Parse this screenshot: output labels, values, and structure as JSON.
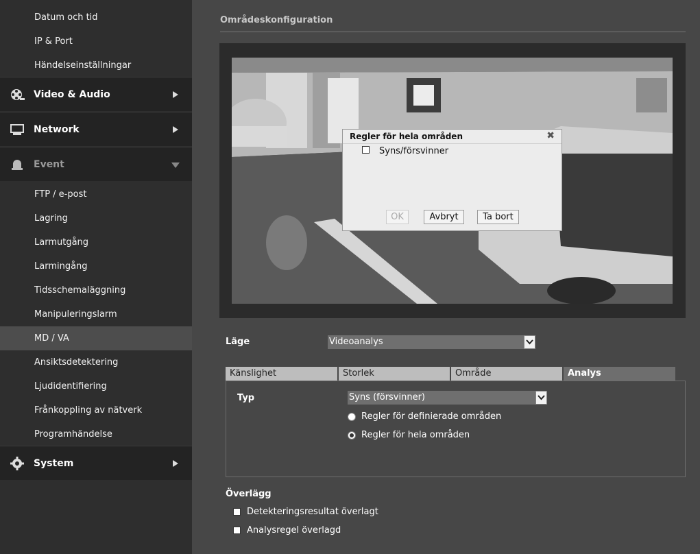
{
  "sidebar": {
    "top_items": [
      {
        "label": "Datum och tid"
      },
      {
        "label": "IP & Port"
      },
      {
        "label": "Händelseinställningar"
      }
    ],
    "sections": {
      "video_audio": {
        "label": "Video & Audio",
        "icon": "film-reel-icon"
      },
      "network": {
        "label": "Network",
        "icon": "monitor-icon"
      },
      "event": {
        "label": "Event",
        "icon": "alarm-bell-icon"
      },
      "system": {
        "label": "System",
        "icon": "gear-icon"
      }
    },
    "event_items": [
      {
        "label": "FTP / e-post"
      },
      {
        "label": "Lagring"
      },
      {
        "label": "Larmutgång"
      },
      {
        "label": "Larmingång"
      },
      {
        "label": "Tidsschemaläggning"
      },
      {
        "label": "Manipuleringslarm"
      },
      {
        "label": "MD / VA"
      },
      {
        "label": "Ansiktsdetektering"
      },
      {
        "label": "Ljudidentifiering"
      },
      {
        "label": "Frånkoppling av nätverk"
      },
      {
        "label": "Programhändelse"
      }
    ],
    "active_item": "MD / VA"
  },
  "main": {
    "title": "Områdeskonfiguration",
    "mode": {
      "label": "Läge",
      "value": "Videoanalys"
    },
    "tabs": [
      {
        "label": "Känslighet"
      },
      {
        "label": "Storlek"
      },
      {
        "label": "Område"
      },
      {
        "label": "Analys"
      }
    ],
    "active_tab": "Analys",
    "analysis": {
      "type_label": "Typ",
      "type_value": "Syns (försvinner)",
      "options": [
        {
          "label": "Regler för definierade områden",
          "selected": false
        },
        {
          "label": "Regler för hela områden",
          "selected": true
        }
      ]
    },
    "overlay": {
      "title": "Överlägg",
      "items": [
        {
          "label": "Detekteringsresultat överlagt",
          "checked": false
        },
        {
          "label": "Analysregel överlagd",
          "checked": false
        }
      ]
    }
  },
  "dialog": {
    "title": "Regler för hela områden",
    "close_glyph": "✖",
    "checkbox_label": "Syns/försvinner",
    "checked": false,
    "buttons": {
      "ok": "OK",
      "cancel": "Avbryt",
      "delete": "Ta bort"
    }
  }
}
